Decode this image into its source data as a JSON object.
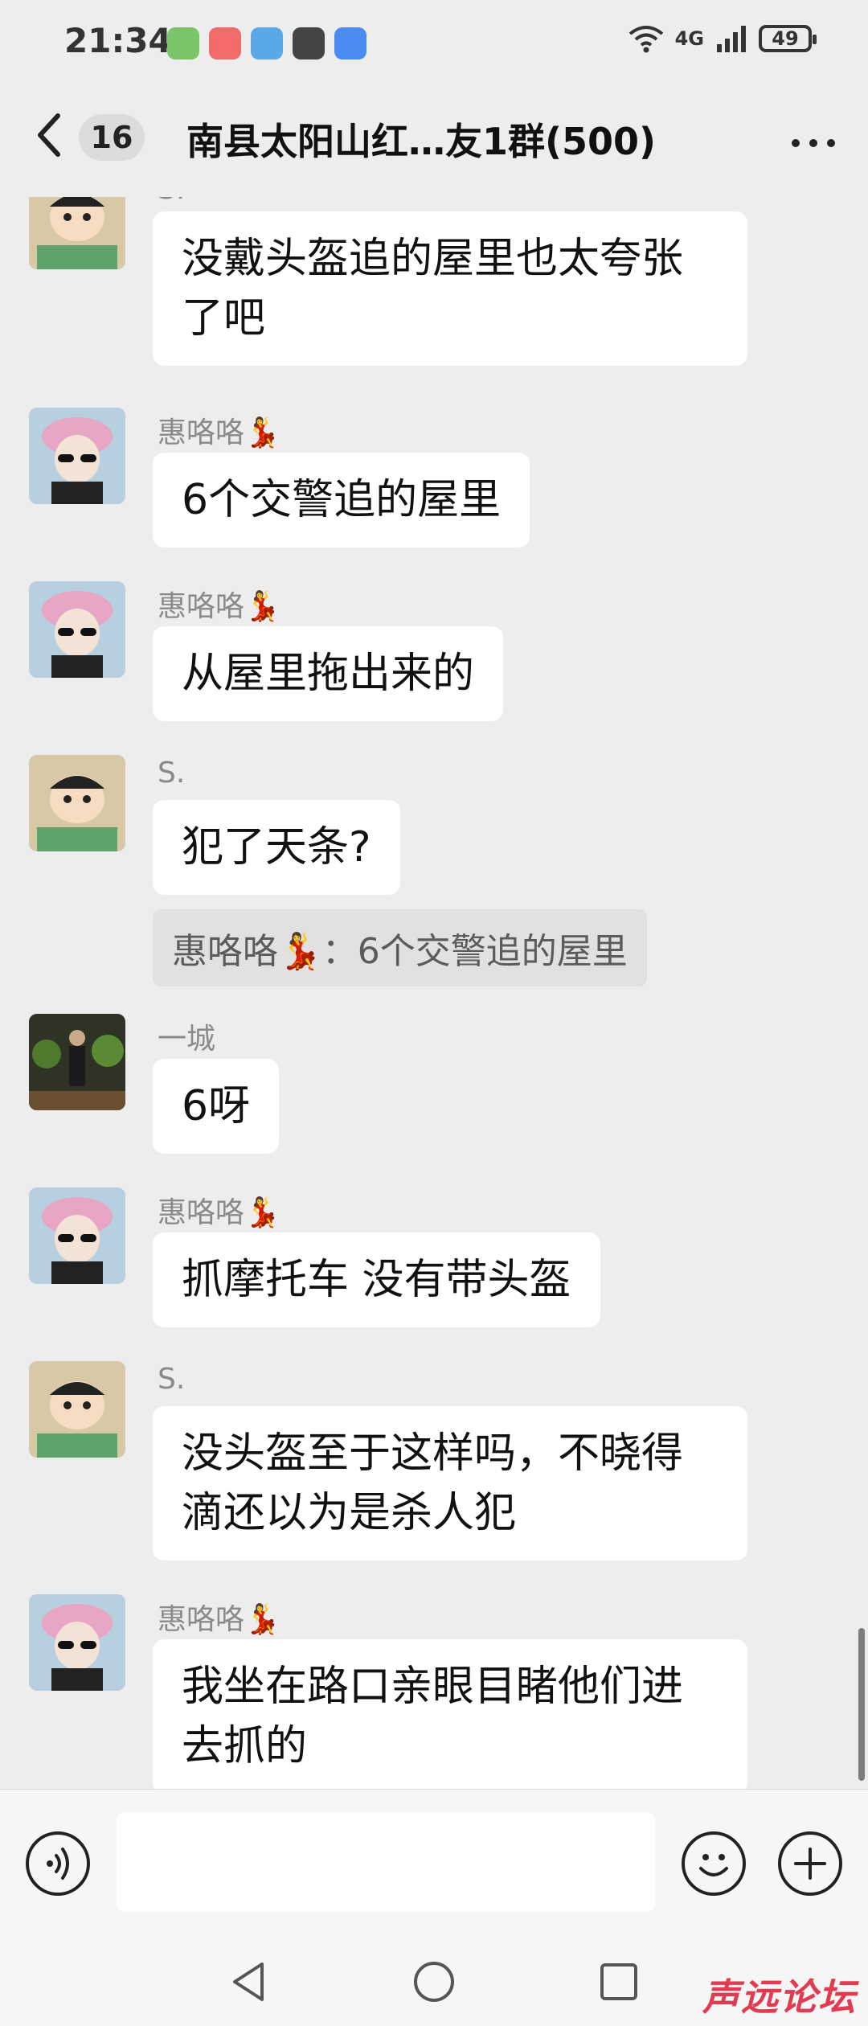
{
  "status_bar": {
    "time": "21:34",
    "network": "4G",
    "battery": "49"
  },
  "header": {
    "back_count": "16",
    "title": "南县太阳山红…友1群(500)"
  },
  "messages": [
    {
      "sender": "S.",
      "text": "没戴头盔追的屋里也太夸张了吧",
      "avatar": "crayon-boy-avatar"
    },
    {
      "sender": "惠咯咯💃",
      "text": "6个交警追的屋里",
      "avatar": "girl-sunglasses-avatar"
    },
    {
      "sender": "惠咯咯💃",
      "text": "从屋里拖出来的",
      "avatar": "girl-sunglasses-avatar"
    },
    {
      "sender": "S.",
      "text": "犯了天条?",
      "quote": "惠咯咯💃：6个交警追的屋里",
      "avatar": "crayon-boy-avatar"
    },
    {
      "sender": "一城",
      "text": "6呀",
      "avatar": "man-plants-avatar"
    },
    {
      "sender": "惠咯咯💃",
      "text": "抓摩托车 没有带头盔",
      "avatar": "girl-sunglasses-avatar"
    },
    {
      "sender": "S.",
      "text": "没头盔至于这样吗，不晓得滴还以为是杀人犯",
      "avatar": "crayon-boy-avatar"
    },
    {
      "sender": "惠咯咯💃",
      "text": "我坐在路口亲眼目睹他们进去抓的",
      "avatar": "girl-sunglasses-avatar"
    }
  ],
  "watermark": "声远论坛",
  "colors": {
    "background": "#ededed",
    "bubble": "#ffffff",
    "quote": "#e1e1e1",
    "watermark": "#e23a50"
  }
}
